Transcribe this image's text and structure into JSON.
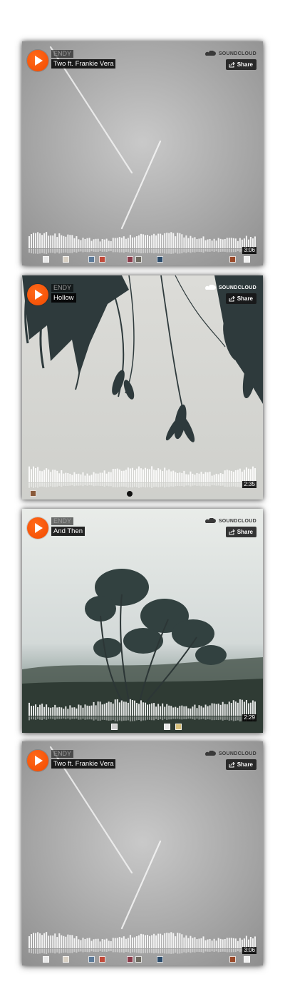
{
  "widgets": [
    {
      "artist": "ENDY",
      "title": "Two ft. Frankie Vera",
      "brand": "SOUNDCLOUD",
      "share_label": "Share",
      "duration": "3:06",
      "artwork": "airplane-contrail-gray-sky"
    },
    {
      "artist": "ENDY",
      "title": "Hollow",
      "brand": "SOUNDCLOUD",
      "share_label": "Share",
      "duration": "2:35",
      "artwork": "willow-branches"
    },
    {
      "artist": "ENDY",
      "title": "And Then",
      "brand": "SOUNDCLOUD",
      "share_label": "Share",
      "duration": "2:29",
      "artwork": "windswept-tree"
    },
    {
      "artist": "ENDY",
      "title": "Two ft. Frankie Vera",
      "brand": "SOUNDCLOUD",
      "share_label": "Share",
      "duration": "3:06",
      "artwork": "airplane-contrail-gray-sky"
    }
  ],
  "icons": {
    "play": "play-icon",
    "cloud": "soundcloud-logo-icon",
    "share": "share-icon"
  },
  "colors": {
    "accent": "#f24a00",
    "label_bg": "#1a1a1a"
  }
}
